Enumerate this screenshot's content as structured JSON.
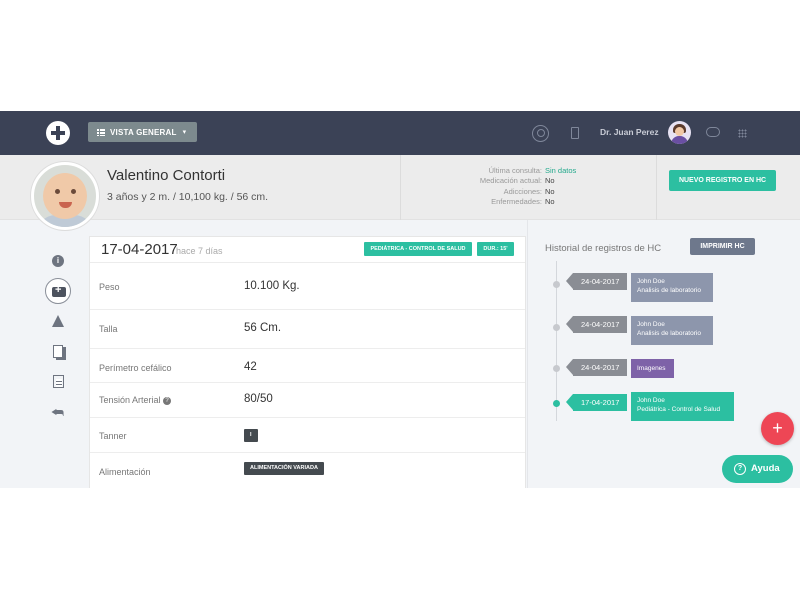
{
  "topbar": {
    "view_button_label": "VISTA GENERAL",
    "user_name": "Dr. Juan Perez"
  },
  "patient": {
    "name": "Valentino Contorti",
    "details": "3 años y 2 m. / 10,100 kg. / 56 cm.",
    "summary": [
      {
        "label": "Última consulta:",
        "value": "Sin datos"
      },
      {
        "label": "Medicación actual:",
        "value": "No"
      },
      {
        "label": "Adicciones:",
        "value": "No"
      },
      {
        "label": "Enfermedades:",
        "value": "No"
      }
    ],
    "new_record_label": "NUEVO REGISTRO EN HC"
  },
  "record": {
    "date": "17-04-2017",
    "ago": "hace 7 días",
    "tags": [
      "PEDIÁTRICA - CONTROL DE SALUD",
      "DUR.: 15'"
    ],
    "fields": [
      {
        "label": "Peso",
        "value": "10.100 Kg."
      },
      {
        "label": "Talla",
        "value": "56 Cm."
      },
      {
        "label": "Perímetro cefálico",
        "value": "42"
      },
      {
        "label": "Tensión Arterial",
        "value": "80/50"
      },
      {
        "label": "Tanner",
        "value": "I"
      },
      {
        "label": "Alimentación",
        "value": "ALIMENTACIÓN VARIADA"
      }
    ]
  },
  "history": {
    "title": "Historial de registros de HC",
    "print_label": "IMPRIMIR HC",
    "entries": [
      {
        "date": "24-04-2017",
        "line1": "John Doe",
        "line2": "Analisis de laboratorio"
      },
      {
        "date": "24-04-2017",
        "line1": "John Doe",
        "line2": "Analisis de laboratorio"
      },
      {
        "date": "24-04-2017",
        "line1": "Imagenes",
        "line2": ""
      },
      {
        "date": "17-04-2017",
        "line1": "John Doe",
        "line2": "Pediátrica - Control de Salud"
      }
    ]
  },
  "fab_label": "+",
  "help_label": "Ayuda",
  "icons": {
    "colors": {
      "topbar": "#3b4256",
      "accent": "#2cbfa1",
      "fab": "#ee4655",
      "history_card": "#8d96ac",
      "history_purple": "#7e62a8"
    }
  }
}
